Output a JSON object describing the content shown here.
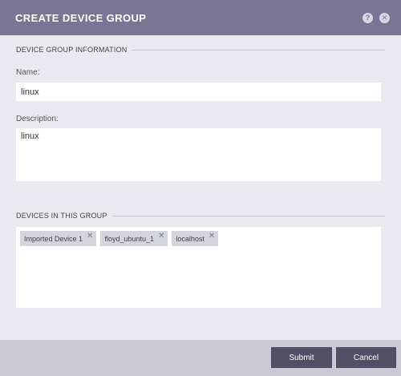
{
  "dialog": {
    "title": "CREATE DEVICE GROUP",
    "help_icon": "question-icon",
    "close_icon": "close-icon"
  },
  "info_section": {
    "heading": "DEVICE GROUP INFORMATION",
    "name_label": "Name:",
    "name_value": "linux",
    "description_label": "Description:",
    "description_value": "linux"
  },
  "devices_section": {
    "heading": "DEVICES IN THIS GROUP",
    "devices": [
      {
        "label": "Imported Device 1"
      },
      {
        "label": "floyd_ubuntu_1"
      },
      {
        "label": "localhost"
      }
    ]
  },
  "footer": {
    "submit_label": "Submit",
    "cancel_label": "Cancel"
  },
  "colors": {
    "header": "#7a7495",
    "background": "#e9e9ef",
    "button": "#514e66",
    "footer": "#cbcad4"
  }
}
